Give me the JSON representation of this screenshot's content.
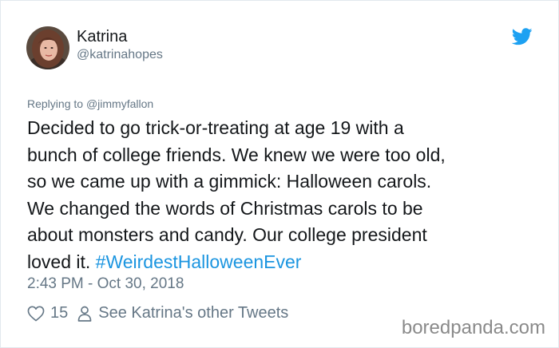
{
  "user": {
    "name": "Katrina",
    "handle": "@katrinahopes"
  },
  "reply": {
    "prefix": "Replying to",
    "mention": "@jimmyfallon"
  },
  "tweet": {
    "text": "Decided to go trick-or-treating at age 19 with a\nbunch of college friends. We knew we were too old,\nso we came up with a gimmick: Halloween carols.\nWe changed the words of Christmas carols to be\nabout monsters and candy. Our college president\nloved it. ",
    "hashtag": "#WeirdestHalloweenEver",
    "timestamp": "2:43 PM - Oct 30, 2018"
  },
  "actions": {
    "like_count": "15",
    "other_tweets_label": "See Katrina's other Tweets"
  },
  "watermark": "boredpanda.com",
  "icons": {
    "like": "heart-icon",
    "profile": "person-icon",
    "brand": "twitter-bird-icon"
  },
  "colors": {
    "twitter_blue": "#1da1f2",
    "hashtag": "#1b95e0",
    "secondary_text": "#657786",
    "primary_text": "#14171a"
  }
}
